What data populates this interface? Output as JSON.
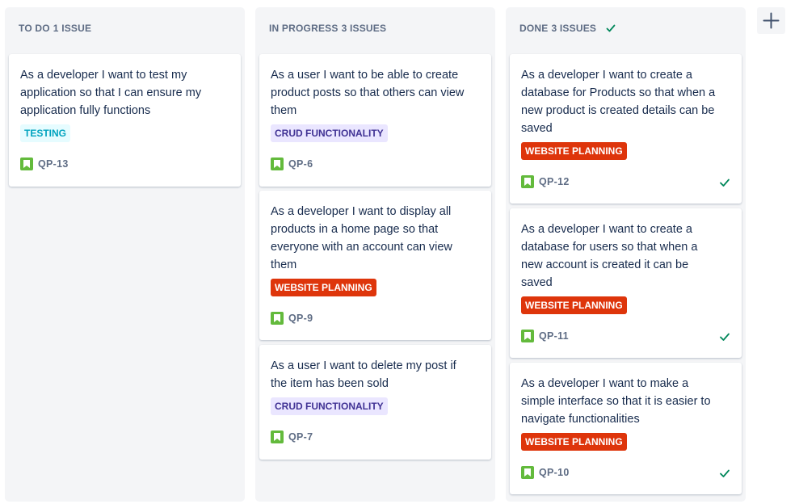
{
  "columns": [
    {
      "name": "TO DO",
      "count": "1 ISSUE",
      "cards": [
        {
          "summary": "As a developer I want to test my application so that I can ensure my application fully functions",
          "label": "TESTING",
          "key": "QP-13"
        }
      ]
    },
    {
      "name": "IN PROGRESS",
      "count": "3 ISSUES",
      "cards": [
        {
          "summary": "As a user I want to be able to create product posts so that others can view them",
          "label": "CRUD FUNCTIONALITY",
          "key": "QP-6"
        },
        {
          "summary": "As a developer I want to display all products in a home page so that everyone with an account can view them",
          "label": "WEBSITE PLANNING",
          "key": "QP-9"
        },
        {
          "summary": "As a user I want to delete my post if the item has been sold",
          "label": "CRUD FUNCTIONALITY",
          "key": "QP-7"
        }
      ]
    },
    {
      "name": "DONE",
      "count": "3 ISSUES",
      "cards": [
        {
          "summary": "As a developer I want to create a database for Products so that when a new product is created details can be saved",
          "label": "WEBSITE PLANNING",
          "key": "QP-12"
        },
        {
          "summary": "As a developer I want to create a database for users so that when a new account is created it can be saved",
          "label": "WEBSITE PLANNING",
          "key": "QP-11"
        },
        {
          "summary": "As a developer I want to make a simple interface so that it is easier to navigate functionalities",
          "label": "WEBSITE PLANNING",
          "key": "QP-10"
        }
      ]
    }
  ],
  "icons": {
    "story": "bookmark-icon",
    "done": "checkmark-icon",
    "add_column": "plus-icon"
  },
  "colors": {
    "story_icon": "#63ba3c",
    "label_web_planning": "#de350b",
    "label_crud": "#eae6ff",
    "label_testing": "#e6fcff",
    "done_check": "#00875a"
  }
}
